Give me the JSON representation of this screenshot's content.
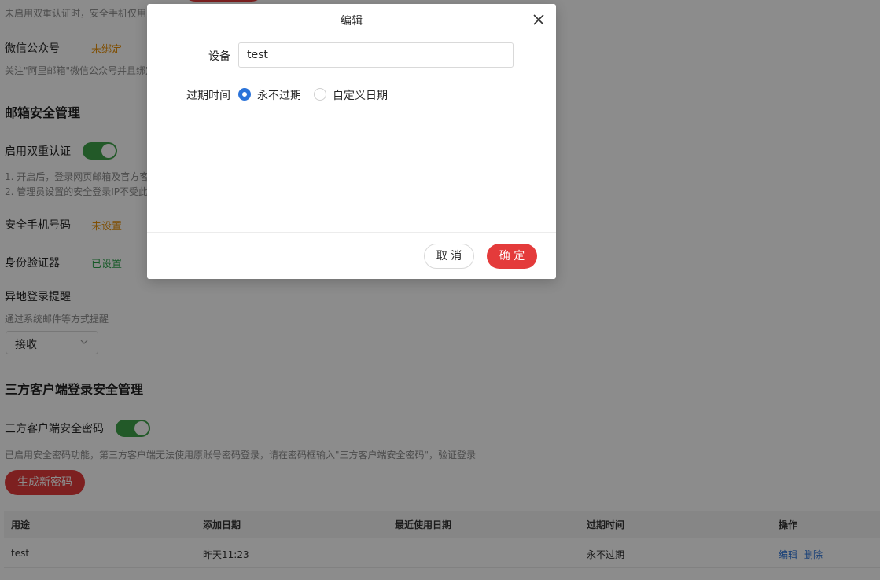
{
  "background": {
    "top_note": "未启用双重认证时，安全手机仅用",
    "wechat": {
      "label": "微信公众号",
      "status": "未绑定",
      "note": "关注\"阿里邮箱\"微信公众号并且绑定"
    },
    "mailbox_section": {
      "title": "邮箱安全管理",
      "two_factor_label": "启用双重认证",
      "two_factor_enabled": true,
      "note1": "1. 开启后，登录网页邮箱及官方客",
      "note2": "2. 管理员设置的安全登录IP不受此",
      "phone_label": "安全手机号码",
      "phone_status": "未设置",
      "auth_label": "身份验证器",
      "auth_status": "已设置",
      "remote_login_label": "异地登录提醒",
      "remote_login_note": "通过系统邮件等方式提醒",
      "remote_login_select": "接收"
    },
    "client_section": {
      "title": "三方客户端登录安全管理",
      "password_label": "三方客户端安全密码",
      "password_enabled": true,
      "note": "已启用安全密码功能，第三方客户端无法使用原账号密码登录，请在密码框输入\"三方客户端安全密码\"，验证登录",
      "generate_button": "生成新密码"
    },
    "table": {
      "columns": [
        "用途",
        "添加日期",
        "最近使用日期",
        "过期时间",
        "操作"
      ],
      "rows": [
        {
          "purpose": "test",
          "added": "昨天11:23",
          "last_used": "",
          "expires": "永不过期",
          "edit": "编辑",
          "delete": "删除"
        }
      ]
    }
  },
  "modal": {
    "title": "编辑",
    "device_label": "设备",
    "device_value": "test",
    "expiry_label": "过期时间",
    "option_never": "永不过期",
    "option_custom": "自定义日期",
    "selected_option": "never",
    "cancel": "取 消",
    "ok": "确 定"
  },
  "colors": {
    "accent_red": "#e43b3b",
    "toggle_green": "#3ea34a",
    "warning_orange": "#e8910a",
    "success_green": "#2aa34a",
    "link_blue": "#2b73d9",
    "radio_blue": "#2b73d9"
  }
}
